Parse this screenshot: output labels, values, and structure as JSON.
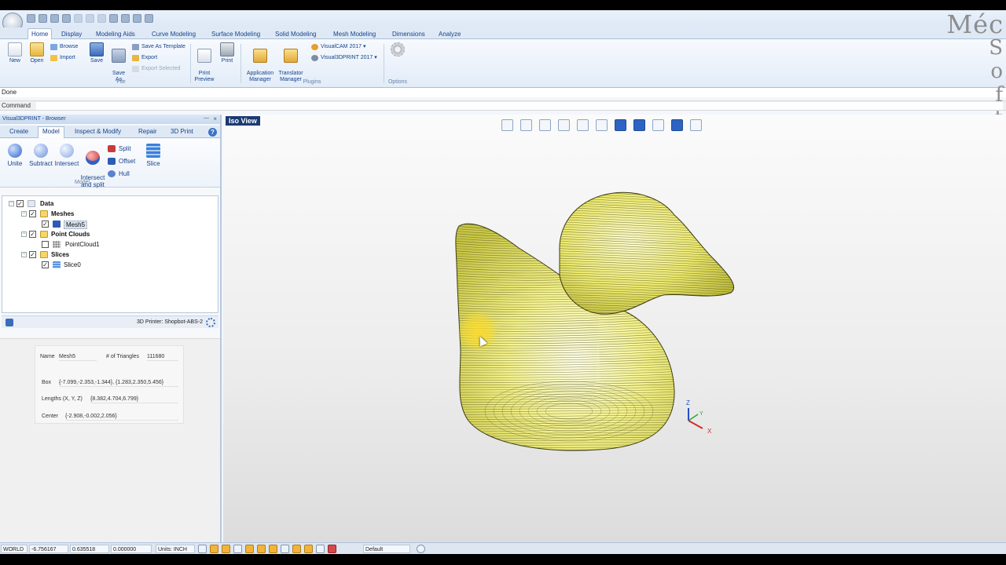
{
  "app": {
    "quick_access_icons": [
      "new-file-icon",
      "open-folder-icon",
      "save-icon",
      "print-icon",
      "cut-icon",
      "copy-icon",
      "paste-icon",
      "undo-icon",
      "redo-icon",
      "refresh-icon",
      "dropdown-icon"
    ]
  },
  "ribbon": {
    "tabs": [
      "Home",
      "Display",
      "Modeling Aids",
      "Curve Modeling",
      "Surface Modeling",
      "Solid Modeling",
      "Mesh Modeling",
      "Dimensions",
      "Analyze"
    ],
    "active_tab": "Home",
    "file_group": {
      "label": "File",
      "new": "New",
      "open": "Open",
      "browse": "Browse",
      "import": "Import",
      "save": "Save",
      "save_as": "Save\nAs",
      "save_as_template": "Save As Template",
      "export": "Export",
      "export_selected": "Export Selected",
      "print_preview": "Print\nPreview",
      "print": "Print"
    },
    "plugins_group": {
      "label": "Plugins",
      "application_manager": "Application\nManager",
      "translator_manager": "Translator\nManager",
      "visualcam": "VisualCAM 2017",
      "visual3dprint": "Visual3DPRINT 2017"
    },
    "options_group": {
      "label": "Options"
    }
  },
  "status": {
    "message": "Done",
    "command_label": "Command",
    "command_value": ""
  },
  "logo": {
    "text": "MecSoft"
  },
  "browser": {
    "title": "Visual3DPRINT - Browser",
    "pin": "―",
    "close": "×",
    "tabs": [
      "Create",
      "Model",
      "Inspect & Modify",
      "Repair",
      "3D Print"
    ],
    "active_tab": "Model",
    "help": "?",
    "model_tools": {
      "unite": "Unite",
      "subtract": "Subtract",
      "intersect": "Intersect",
      "intersect_split": "Intersect\nand split",
      "split": "Split",
      "offset": "Offset",
      "hull": "Hull",
      "slice": "Slice",
      "group_label": "Model"
    },
    "tree": {
      "root": "Data",
      "meshes": "Meshes",
      "mesh5": "Mesh5",
      "point_clouds": "Point Clouds",
      "pointcloud1": "PointCloud1",
      "slices": "Slices",
      "slice0": "Slice0",
      "expander": "−",
      "check": "✓"
    },
    "printer": "3D Printer: Shopbot-ABS-2"
  },
  "properties": {
    "name_label": "Name",
    "name_value": "Mesh5",
    "triangles_label": "# of Triangles",
    "triangles_value": "111680",
    "box_label": "Box",
    "box_value": "{-7.099,-2.353,-1.344}, {1.283,2.350,5.456}",
    "lengths_label": "Lengths (X, Y, Z)",
    "lengths_value": "{8.382,4.704,6.799}",
    "center_label": "Center",
    "center_value": "{-2.908,-0.002,2.056}"
  },
  "viewport": {
    "title": "Iso View",
    "tools": [
      "zoom-out-icon",
      "zoom-in-icon",
      "zoom-window-icon",
      "zoom-extents-icon",
      "zoom-selected-icon",
      "pan-icon",
      "view-plane-icon",
      "view-cube-icon",
      "home-view-icon",
      "shaded-mode-icon",
      "display-mode-icon"
    ],
    "model_color": "#f4f28a",
    "contour_color": "#2d2d12",
    "axis_labels": {
      "z": "Z",
      "y": "Y",
      "x": "X"
    }
  },
  "statusbar": {
    "mode": "WORLD",
    "x": "-6.756167",
    "y": "0.635518",
    "z": "0.000000",
    "units": "Units: INCH",
    "layer": "Default"
  }
}
